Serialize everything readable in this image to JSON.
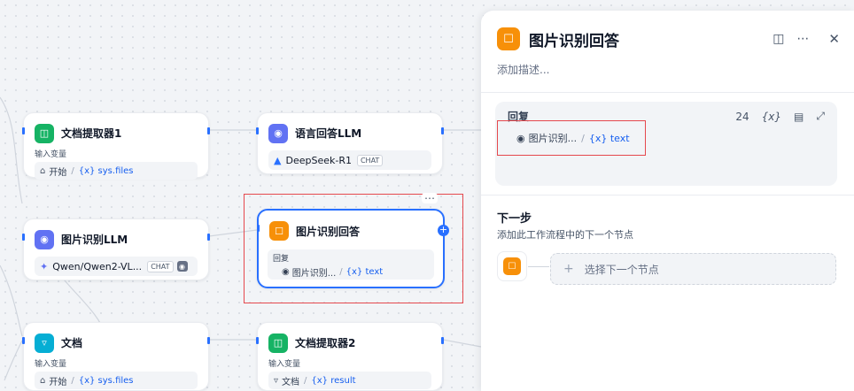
{
  "nodes": {
    "doc_extractor1": {
      "title": "文档提取器1",
      "sub": "输入变量",
      "src": "开始",
      "var": "{x} sys.files"
    },
    "llm_lang": {
      "title": "语言回答LLM",
      "model": "DeepSeek-R1",
      "badge": "CHAT"
    },
    "llm_image": {
      "title": "图片识别LLM",
      "model": "Qwen/Qwen2-VL...",
      "badge": "CHAT"
    },
    "answer_image": {
      "title": "图片识别回答",
      "sub": "回复",
      "src": "图片识别...",
      "var": "{x} text"
    },
    "doc": {
      "title": "文档",
      "sub": "输入变量",
      "src": "开始",
      "var": "{x} sys.files"
    },
    "doc_extractor2": {
      "title": "文档提取器2",
      "sub": "输入变量",
      "src": "文档",
      "var": "{x} result"
    }
  },
  "panel": {
    "title": "图片识别回答",
    "desc_placeholder": "添加描述...",
    "reply_label": "回复",
    "char_count": "24",
    "chip_src": "图片识别...",
    "chip_var": "{x} text",
    "next_title": "下一步",
    "next_desc": "添加此工作流程中的下一个节点",
    "next_select": "选择下一个节点"
  },
  "colors": {
    "accent": "#2970ff",
    "highlight_red": "#e5484d",
    "extractor_green": "#16b364",
    "llm_purple": "#6172f3",
    "answer_orange": "#f79009",
    "doc_cyan": "#06aed4"
  }
}
